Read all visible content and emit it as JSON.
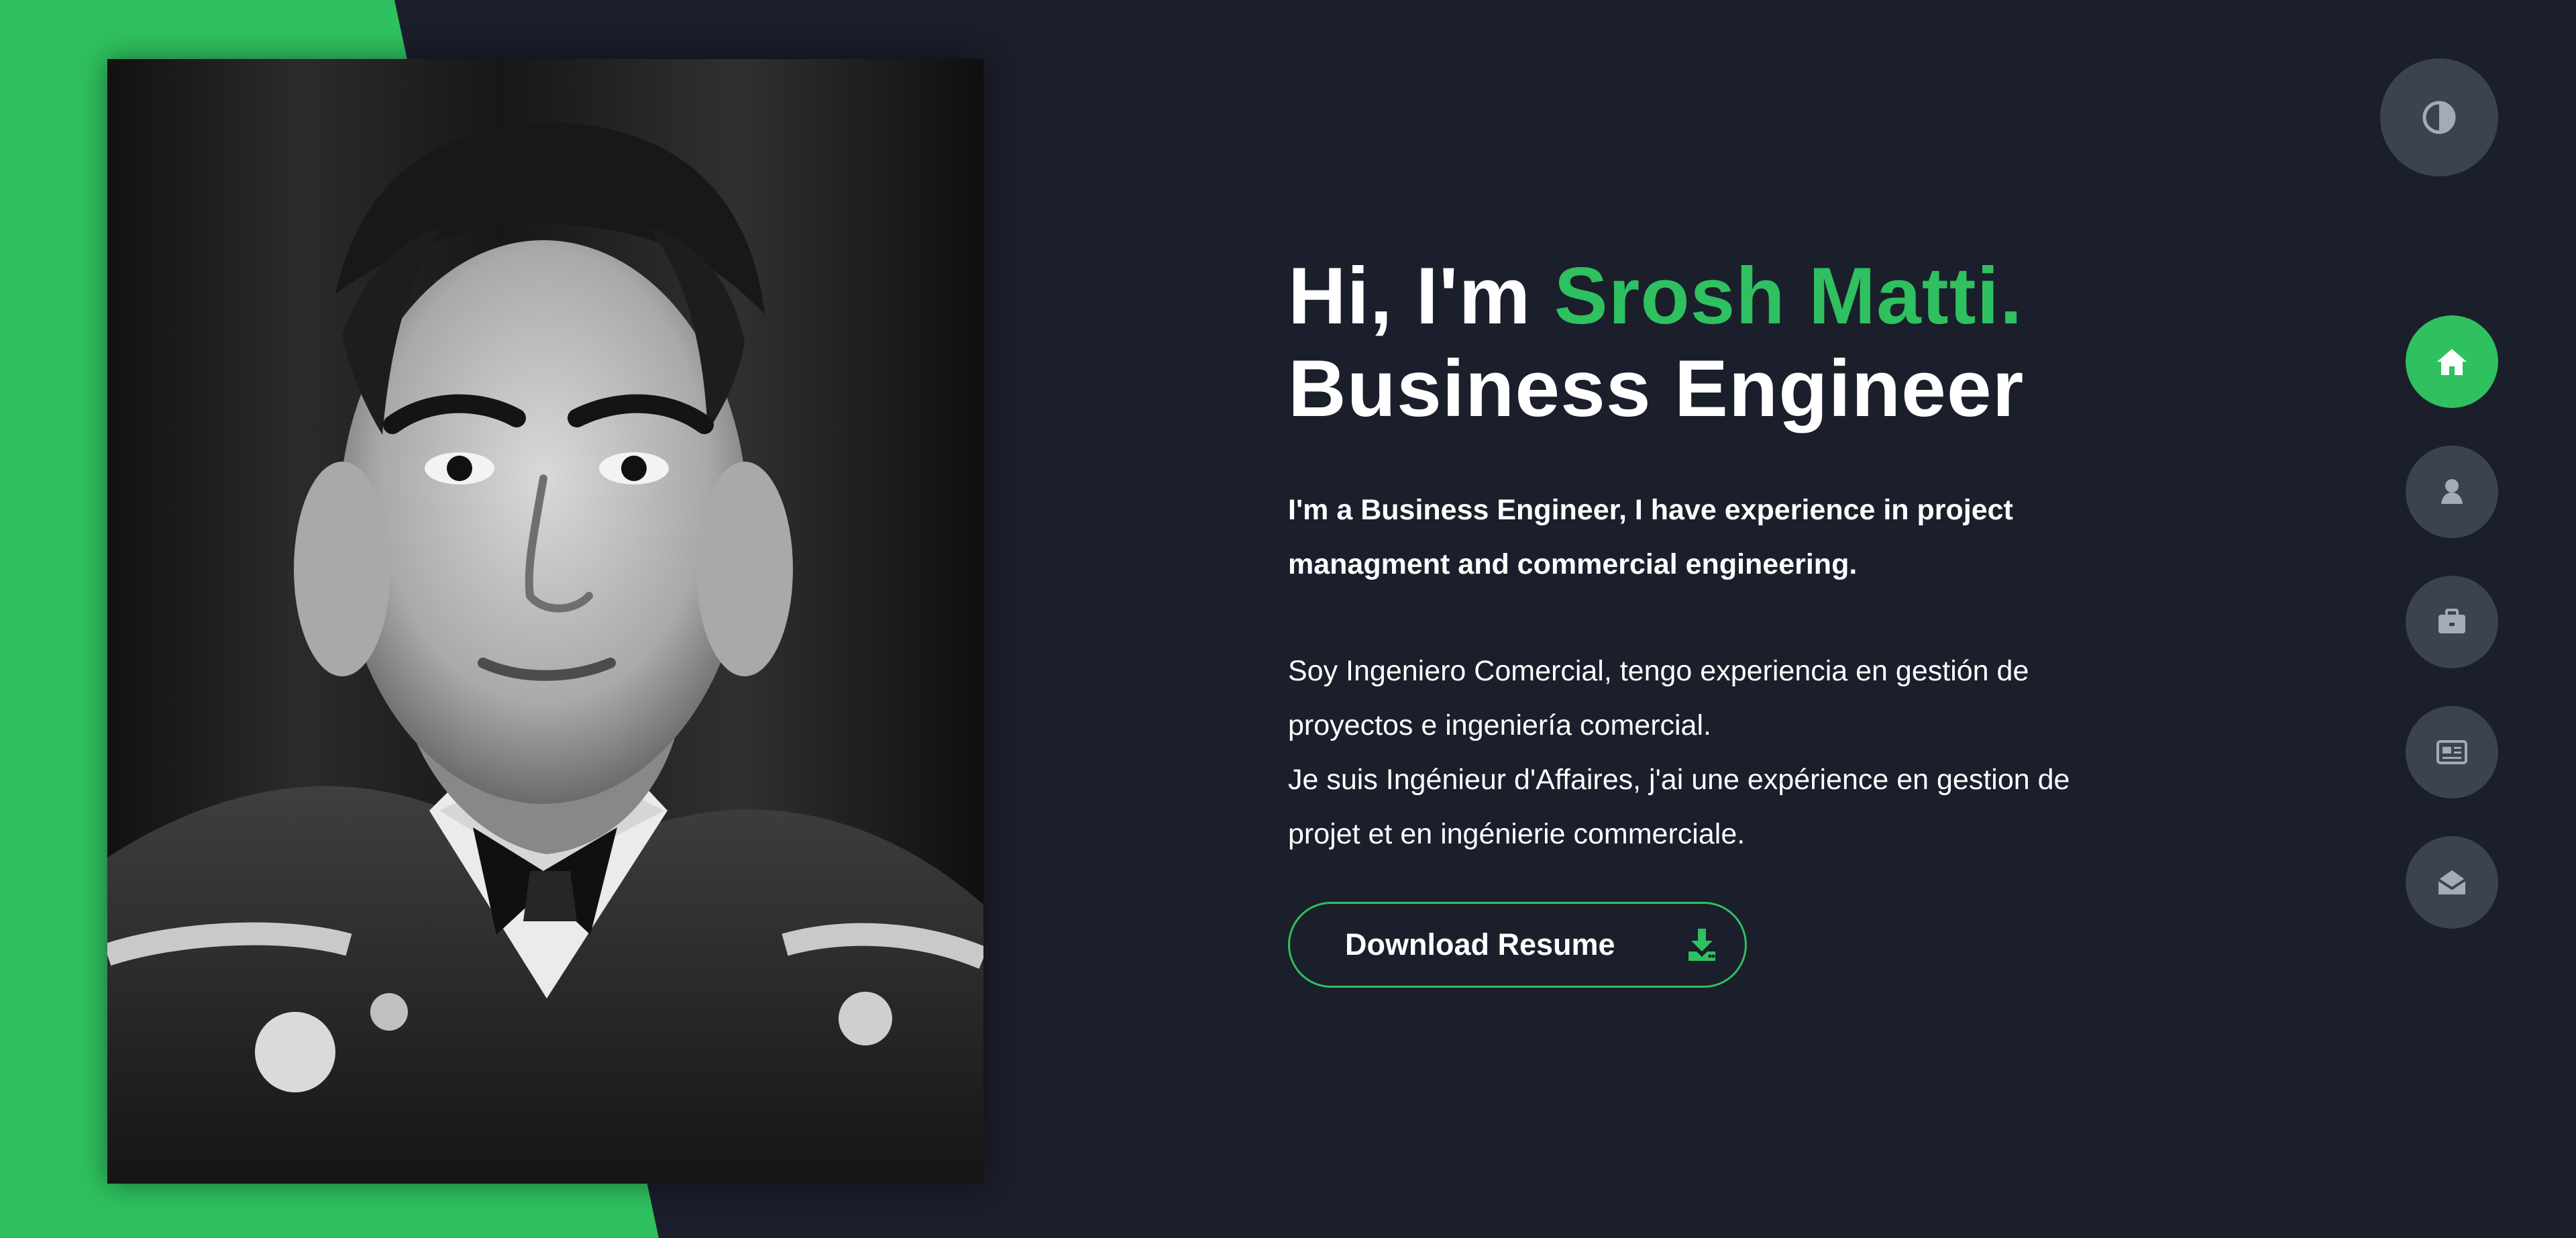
{
  "hero": {
    "greeting_prefix": "Hi, I'm ",
    "name": "Srosh Matti.",
    "title": "Business Engineer",
    "intro_en": "I'm a Business Engineer, I have experience in project managment and commercial engineering.",
    "intro_es": "Soy Ingeniero Comercial, tengo experiencia en gestión de proyectos e ingeniería comercial.",
    "intro_fr": "Je suis Ingénieur d'Affaires, j'ai une expérience en gestion de projet et en ingénierie commerciale.",
    "download_label": "Download Resume"
  },
  "navigation": {
    "items": [
      {
        "icon": "home-icon",
        "active": true
      },
      {
        "icon": "user-icon",
        "active": false
      },
      {
        "icon": "briefcase-icon",
        "active": false
      },
      {
        "icon": "newspaper-icon",
        "active": false
      },
      {
        "icon": "envelope-open-icon",
        "active": false
      }
    ]
  },
  "theme_toggle": {
    "icon": "contrast-icon"
  },
  "colors": {
    "accent": "#2fc05f",
    "background": "#1b1e2b",
    "nav_button": "#3b4350",
    "text": "#ffffff"
  }
}
